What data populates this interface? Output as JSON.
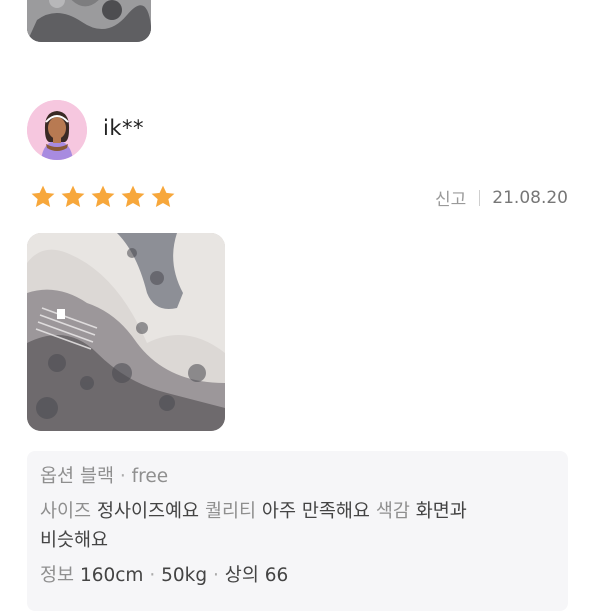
{
  "review": {
    "username": "ik**",
    "rating": 5,
    "report_label": "신고",
    "date": "21.08.20",
    "option": {
      "label": "옵션",
      "color": "블랙",
      "size": "free"
    },
    "size_fit": {
      "label": "사이즈",
      "value": "정사이즈예요"
    },
    "quality": {
      "label": "퀄리티",
      "value": "아주 만족해요"
    },
    "color_match": {
      "label": "색감",
      "line1": "화면과",
      "line2": "비슷해요"
    },
    "body_info": {
      "label": "정보",
      "height": "160cm",
      "weight": "50kg",
      "top_size": "상의 66"
    }
  },
  "colors": {
    "star": "#f7a73b",
    "avatar_bg": "#f6c7df",
    "info_box_bg": "#f6f6f8"
  },
  "icons": [
    "star-icon",
    "avatar-illustration"
  ]
}
